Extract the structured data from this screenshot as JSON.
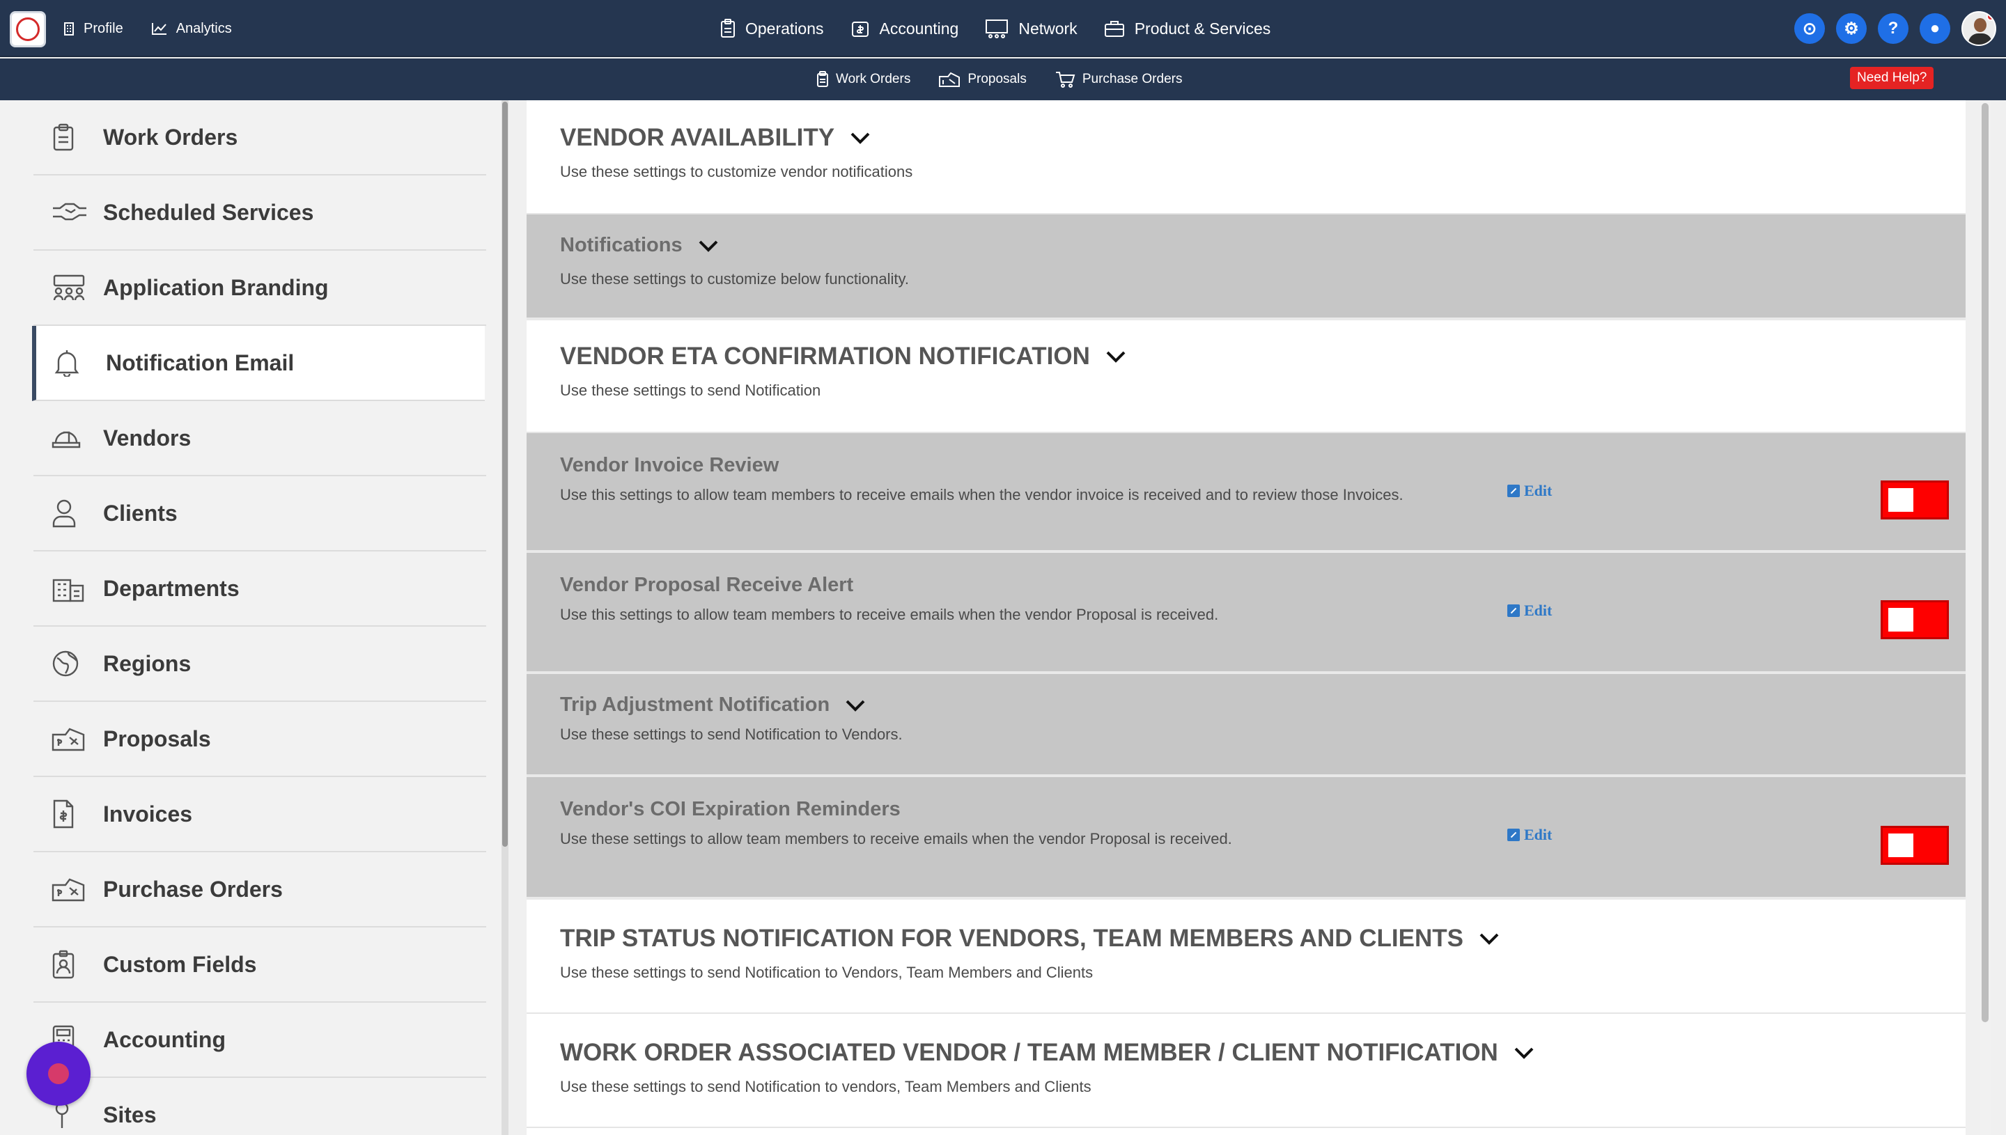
{
  "topbar": {
    "left_nav": [
      {
        "label": "Profile",
        "icon": "building-icon"
      },
      {
        "label": "Analytics",
        "icon": "chart-line-icon"
      }
    ],
    "center_nav": [
      {
        "label": "Operations",
        "icon": "clipboard-icon"
      },
      {
        "label": "Accounting",
        "icon": "money-box-icon"
      },
      {
        "label": "Network",
        "icon": "network-icon"
      },
      {
        "label": "Product & Services",
        "icon": "briefcase-icon"
      }
    ],
    "right_icons": [
      {
        "name": "dashboard-icon",
        "glyph": "⊙"
      },
      {
        "name": "gear-icon",
        "glyph": "⚙"
      },
      {
        "name": "help-icon",
        "glyph": "?"
      },
      {
        "name": "chat-icon",
        "glyph": "●"
      }
    ]
  },
  "subbar": {
    "items": [
      {
        "label": "Work Orders",
        "icon": "clipboard-icon"
      },
      {
        "label": "Proposals",
        "icon": "proposal-icon"
      },
      {
        "label": "Purchase Orders",
        "icon": "cart-icon"
      }
    ],
    "need_help": "Need Help?"
  },
  "sidebar": {
    "items": [
      {
        "label": "Work Orders",
        "icon": "clipboard-icon"
      },
      {
        "label": "Scheduled Services",
        "icon": "handshake-icon"
      },
      {
        "label": "Application Branding",
        "icon": "team-icon"
      },
      {
        "label": "Notification Email",
        "icon": "bell-icon",
        "active": true
      },
      {
        "label": "Vendors",
        "icon": "hard-hat-icon"
      },
      {
        "label": "Clients",
        "icon": "user-icon"
      },
      {
        "label": "Departments",
        "icon": "building-icon"
      },
      {
        "label": "Regions",
        "icon": "globe-icon"
      },
      {
        "label": "Proposals",
        "icon": "proposal-icon"
      },
      {
        "label": "Invoices",
        "icon": "invoice-icon"
      },
      {
        "label": "Purchase Orders",
        "icon": "proposal-icon"
      },
      {
        "label": "Custom Fields",
        "icon": "id-badge-icon"
      },
      {
        "label": "Accounting",
        "icon": "calculator-icon"
      },
      {
        "label": "Sites",
        "icon": "map-pin-icon"
      }
    ]
  },
  "main": {
    "sections": [
      {
        "title": "VENDOR AVAILABILITY",
        "desc": "Use these settings to customize vendor notifications",
        "style": "white"
      },
      {
        "title": "Notifications",
        "desc": "Use these settings to customize below functionality.",
        "style": "gray"
      },
      {
        "title": "VENDOR ETA CONFIRMATION NOTIFICATION",
        "desc": "Use these settings to send Notification",
        "style": "white"
      },
      {
        "title": "Vendor Invoice Review",
        "desc": "Use this settings to allow team members to receive emails when the vendor invoice is received and to review those Invoices.",
        "style": "gray",
        "edit": "Edit",
        "toggle_on": true
      },
      {
        "title": "Vendor Proposal Receive Alert",
        "desc": "Use this settings to allow team members to receive emails when the vendor Proposal is received.",
        "style": "gray",
        "edit": "Edit",
        "toggle_on": true
      },
      {
        "title": "Trip Adjustment Notification",
        "desc": "Use these settings to send Notification to Vendors.",
        "style": "gray"
      },
      {
        "title": "Vendor's COI Expiration Reminders",
        "desc": "Use these settings to allow team members to receive emails when the vendor Proposal is received.",
        "style": "gray",
        "edit": "Edit",
        "toggle_on": true
      },
      {
        "title": "TRIP STATUS NOTIFICATION FOR VENDORS, TEAM MEMBERS AND CLIENTS",
        "desc": "Use these settings to send Notification to Vendors, Team Members and Clients",
        "style": "white"
      },
      {
        "title": "WORK ORDER ASSOCIATED VENDOR / TEAM MEMBER / CLIENT NOTIFICATION",
        "desc": "Use these settings to send Notification to vendors, Team Members and Clients",
        "style": "white"
      }
    ]
  },
  "colors": {
    "topbar": "#253650",
    "toggle": "#fe0000",
    "accent": "#1f6fe6",
    "help_badge": "#e52323"
  }
}
